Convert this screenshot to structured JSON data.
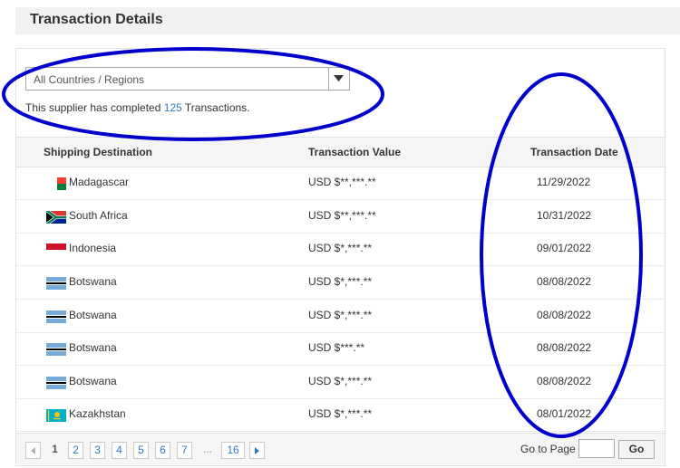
{
  "header": {
    "title": "Transaction Details"
  },
  "filter": {
    "selected": "All Countries / Regions"
  },
  "summary": {
    "prefix": "This supplier has completed",
    "count": "125",
    "suffix": "Transactions."
  },
  "table": {
    "columns": [
      "Shipping Destination",
      "Transaction Value",
      "Transaction Date"
    ],
    "rows": [
      {
        "country": "Madagascar",
        "flag": "madagascar-flag-icon",
        "value": "USD $**,***.**",
        "date": "11/29/2022"
      },
      {
        "country": "South Africa",
        "flag": "south-africa-flag-icon",
        "value": "USD $**,***.**",
        "date": "10/31/2022"
      },
      {
        "country": "Indonesia",
        "flag": "indonesia-flag-icon",
        "value": "USD $*,***.**",
        "date": "09/01/2022"
      },
      {
        "country": "Botswana",
        "flag": "botswana-flag-icon",
        "value": "USD $*,***.**",
        "date": "08/08/2022"
      },
      {
        "country": "Botswana",
        "flag": "botswana-flag-icon",
        "value": "USD $*,***.**",
        "date": "08/08/2022"
      },
      {
        "country": "Botswana",
        "flag": "botswana-flag-icon",
        "value": "USD $***.**",
        "date": "08/08/2022"
      },
      {
        "country": "Botswana",
        "flag": "botswana-flag-icon",
        "value": "USD $*,***.**",
        "date": "08/08/2022"
      },
      {
        "country": "Kazakhstan",
        "flag": "kazakhstan-flag-icon",
        "value": "USD $*,***.**",
        "date": "08/01/2022"
      }
    ]
  },
  "pagination": {
    "current": "1",
    "pages": [
      "2",
      "3",
      "4",
      "5",
      "6",
      "7"
    ],
    "ellipsis": "...",
    "last": "16",
    "goto_label": "Go to Page",
    "goto_value": "",
    "go_label": "Go"
  },
  "colors": {
    "accent_link": "#2f78c4",
    "annotation": "#0000cc",
    "header_bg": "#f2f2f2"
  }
}
